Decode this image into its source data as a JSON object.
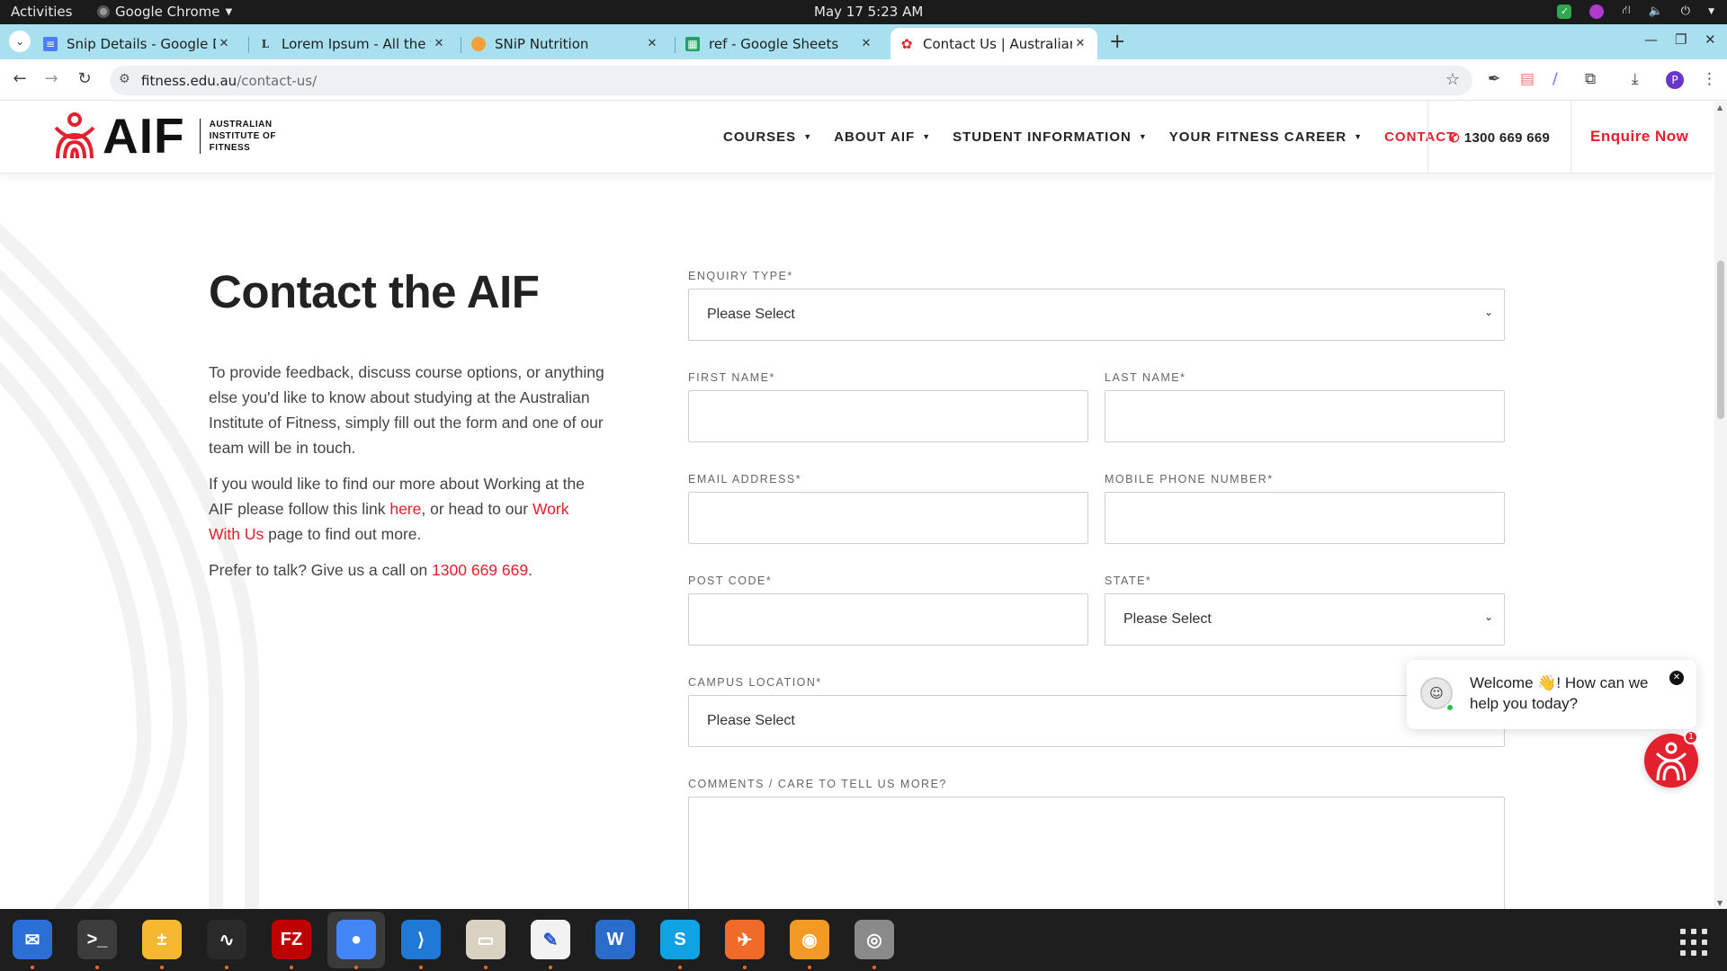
{
  "os": {
    "activities": "Activities",
    "app_name": "Google Chrome",
    "clock": "May 17  5:23 AM"
  },
  "browser": {
    "tabs": [
      {
        "title": "Snip Details - Google Do",
        "favicon": "google-docs-icon",
        "color": "#4a80f5"
      },
      {
        "title": "Lorem Ipsum - All the fac",
        "favicon": "lorem-ipsum-icon",
        "color": "#333333"
      },
      {
        "title": "SNiP Nutrition",
        "favicon": "snip-nutrition-icon",
        "color": "#f2a03b"
      },
      {
        "title": "ref - Google Sheets",
        "favicon": "google-sheets-icon",
        "color": "#1fa463"
      },
      {
        "title": "Contact Us | Australian In",
        "favicon": "aif-icon",
        "color": "#e2202e",
        "active": true
      }
    ],
    "url_host": "fitness.edu.au",
    "url_path": "/contact-us/",
    "profile_initial": "P"
  },
  "site": {
    "logo_text": "AIF",
    "logo_sub": [
      "AUSTRALIAN",
      "INSTITUTE OF",
      "FITNESS"
    ],
    "nav": [
      {
        "label": "COURSES",
        "dropdown": true
      },
      {
        "label": "ABOUT AIF",
        "dropdown": true
      },
      {
        "label": "STUDENT INFORMATION",
        "dropdown": true
      },
      {
        "label": "YOUR FITNESS CAREER",
        "dropdown": true
      },
      {
        "label": "CONTACT",
        "dropdown": false
      }
    ],
    "phone": "1300 669 669",
    "enquire": "Enquire Now",
    "accent": "#e2202e"
  },
  "content": {
    "heading": "Contact the AIF",
    "p1": "To provide feedback, discuss course options, or anything else you'd like to know about studying at the Australian Institute of Fitness, simply fill out the form and one of our team will be in touch.",
    "p2_a": "If you would like to find our more about Working at the AIF please follow this link ",
    "p2_link1": "here",
    "p2_b": ", or head to our ",
    "p2_link2": "Work With Us",
    "p2_c": " page to find out more.",
    "p3_a": "Prefer to talk? Give us a call on ",
    "p3_phone": "1300 669 669",
    "p3_c": "."
  },
  "form": {
    "enquiry_type": {
      "label": "ENQUIRY TYPE*",
      "value": "Please Select"
    },
    "first_name": {
      "label": "FIRST NAME*",
      "value": ""
    },
    "last_name": {
      "label": "LAST NAME*",
      "value": ""
    },
    "email": {
      "label": "EMAIL ADDRESS*",
      "value": ""
    },
    "mobile": {
      "label": "MOBILE PHONE NUMBER*",
      "value": ""
    },
    "post_code": {
      "label": "POST CODE*",
      "value": ""
    },
    "state": {
      "label": "STATE*",
      "value": "Please Select"
    },
    "campus": {
      "label": "CAMPUS LOCATION*",
      "value": "Please Select"
    },
    "comments": {
      "label": "COMMENTS / CARE TO TELL US MORE?",
      "value": ""
    }
  },
  "chat": {
    "message": "Welcome 👋! How can we help you today?",
    "badge": "1"
  },
  "dock": [
    {
      "name": "thunderbird-icon",
      "color": "#2b6fd6",
      "glyph": "✉",
      "running": true
    },
    {
      "name": "terminal-icon",
      "color": "#3c3c3c",
      "glyph": ">_",
      "running": true
    },
    {
      "name": "calculator-icon",
      "color": "#f5b82e",
      "glyph": "±",
      "running": true
    },
    {
      "name": "system-monitor-icon",
      "color": "#2a2a2a",
      "glyph": "∿",
      "running": true
    },
    {
      "name": "filezilla-icon",
      "color": "#bf0000",
      "glyph": "FZ",
      "running": true
    },
    {
      "name": "chrome-icon",
      "color": "#4285f4",
      "glyph": "●",
      "running": true
    },
    {
      "name": "vscode-icon",
      "color": "#1e7ad4",
      "glyph": "⟩",
      "running": true
    },
    {
      "name": "files-icon",
      "color": "#d9d2c3",
      "glyph": "▭",
      "running": true
    },
    {
      "name": "text-editor-icon",
      "color": "#f2f2f2",
      "glyph": "✎",
      "running": true
    },
    {
      "name": "libreoffice-writer-icon",
      "color": "#2a6cc9",
      "glyph": "W",
      "running": false
    },
    {
      "name": "skype-icon",
      "color": "#0fa3e4",
      "glyph": "S",
      "running": true
    },
    {
      "name": "postman-icon",
      "color": "#f06b2a",
      "glyph": "✈",
      "running": true
    },
    {
      "name": "blender-like-icon",
      "color": "#f39a24",
      "glyph": "◉",
      "running": true
    },
    {
      "name": "disk-icon",
      "color": "#8a8a8a",
      "glyph": "◎",
      "running": true
    }
  ]
}
